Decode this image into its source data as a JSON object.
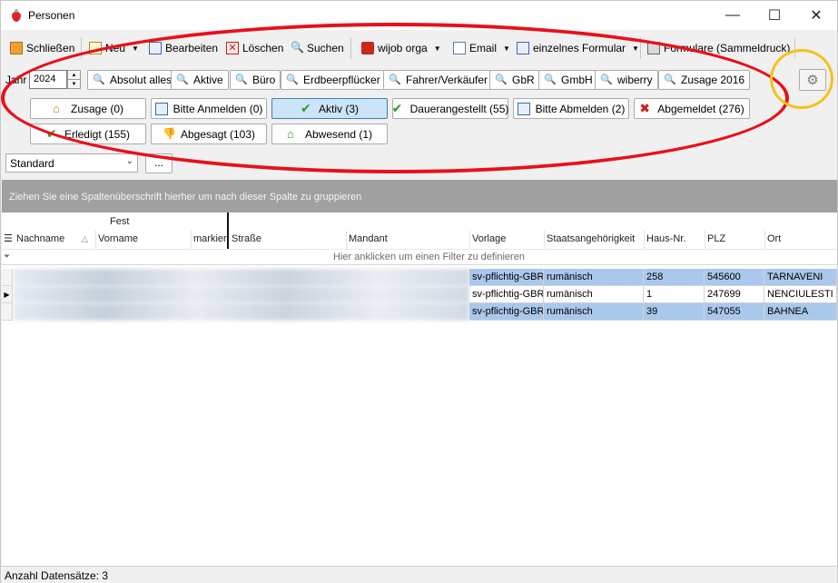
{
  "window": {
    "title": "Personen",
    "minimize": "—",
    "maximize": "☐",
    "close": "✕"
  },
  "toolbar": {
    "close_label": "Schließen",
    "new_label": "Neu",
    "edit_label": "Bearbeiten",
    "delete_label": "Löschen",
    "search_label": "Suchen",
    "wijob_label": "wijob orga",
    "email_label": "Email",
    "form_label": "einzelnes Formular",
    "forms_bulk_label": "Formulare (Sammeldruck)"
  },
  "filters": {
    "year_label": "Jahr",
    "year_value": "2024",
    "buttons": [
      "Absolut alles",
      "Aktive",
      "Büro",
      "Erdbeerpflücker",
      "Fahrer/Verkäufer",
      "GbR",
      "GmbH",
      "wiberry",
      "Zusage 2016"
    ]
  },
  "status_buttons": {
    "zusage": "Zusage (0)",
    "bitte_anmelden": "Bitte Anmelden (0)",
    "aktiv": "Aktiv (3)",
    "dauerangestellt": "Dauerangestellt (55)",
    "bitte_abmelden": "Bitte Abmelden (2)",
    "abgemeldet": "Abgemeldet (276)",
    "erledigt": "Erledigt (155)",
    "abgesagt": "Abgesagt (103)",
    "abwesend": "Abwesend (1)"
  },
  "layout": {
    "selected": "Standard",
    "more": "..."
  },
  "group_panel_text": "Ziehen Sie eine Spaltenüberschrift hierher um nach dieser Spalte zu gruppieren",
  "grid": {
    "band_label": "Fest",
    "columns": [
      "Nachname",
      "Vorname",
      "markier",
      "Straße",
      "Mandant",
      "Vorlage",
      "Staatsangehörigkeit",
      "Haus-Nr.",
      "PLZ",
      "Ort"
    ],
    "filter_hint": "Hier anklicken um einen Filter zu definieren",
    "rows": [
      {
        "vorlage": "sv-pflichtig-GBR",
        "staat": "rumänisch",
        "hausnr": "258",
        "plz": "545600",
        "ort": "TARNAVENI"
      },
      {
        "vorlage": "sv-pflichtig-GBR",
        "staat": "rumänisch",
        "hausnr": "1",
        "plz": "247699",
        "ort": "NENCIULESTI"
      },
      {
        "vorlage": "sv-pflichtig-GBR",
        "staat": "rumänisch",
        "hausnr": "39",
        "plz": "547055",
        "ort": "BAHNEA"
      }
    ]
  },
  "status_bar": "Anzahl Datensätze: 3",
  "colors": {
    "selection": "#a9c8ec",
    "active_button": "#cce4f7",
    "annotation_red": "#e8101a",
    "annotation_yellow": "#f2c31a"
  }
}
